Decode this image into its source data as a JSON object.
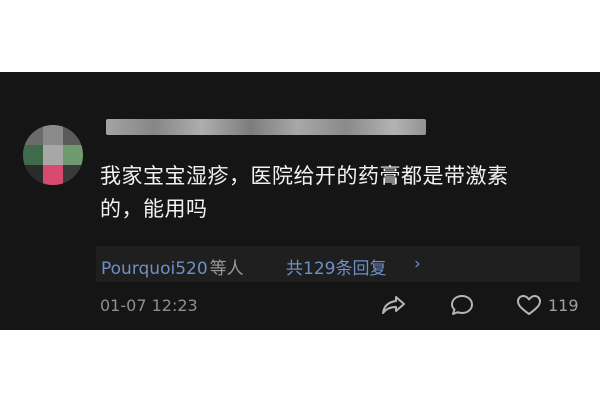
{
  "comment": {
    "text_line1": "我家宝宝湿疹，医院给开的药膏都是带激素",
    "text_line2": "的，能用吗"
  },
  "replies": {
    "user": "Pourquoi520",
    "etc_label": "等人",
    "total_label": "共129条回复",
    "chevron": "›"
  },
  "meta": {
    "timestamp": "01-07 12:23",
    "likes": "119"
  },
  "icons": [
    "share-icon",
    "comment-icon",
    "heart-icon",
    "chevron-right-icon"
  ],
  "colors": {
    "background": "#151515",
    "text": "#f2f2f2",
    "link": "#6f8fc8",
    "muted": "#8e8e8e"
  }
}
